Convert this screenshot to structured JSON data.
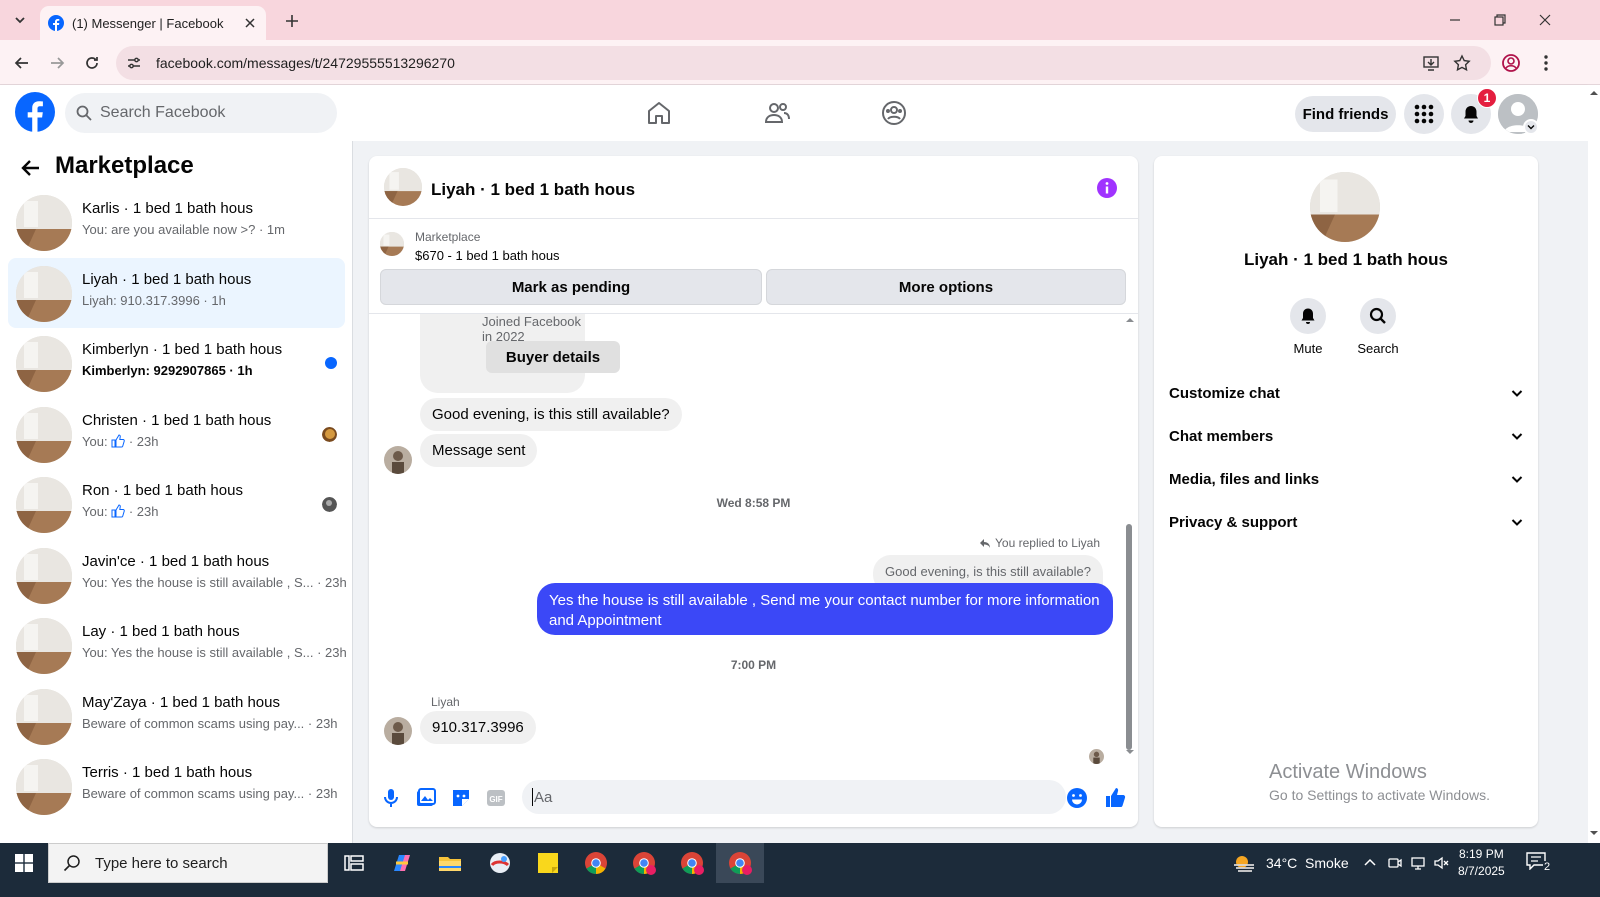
{
  "browser": {
    "tab_title": "(1) Messenger | Facebook",
    "url": "facebook.com/messages/t/24729555513296270"
  },
  "fb_header": {
    "search_placeholder": "Search Facebook",
    "find_friends": "Find friends",
    "notification_count": "1"
  },
  "sidebar": {
    "title": "Marketplace",
    "conversations": [
      {
        "name": "Karlis · 1 bed 1 bath hous",
        "preview": "You: are you available now >? · 1m"
      },
      {
        "name": "Liyah · 1 bed 1 bath hous",
        "preview": "Liyah: 910.317.3996 · 1h"
      },
      {
        "name": "Kimberlyn · 1 bed 1 bath hous",
        "preview": "Kimberlyn: 9292907865 · 1h"
      },
      {
        "name": "Christen · 1 bed 1 bath hous",
        "preview_prefix": "You:",
        "preview_suffix": "· 23h"
      },
      {
        "name": "Ron · 1 bed 1 bath hous",
        "preview_prefix": "You:",
        "preview_suffix": "· 23h"
      },
      {
        "name": "Javin'ce · 1 bed 1 bath hous",
        "preview": "You: Yes the house is still available , S... · 23h"
      },
      {
        "name": "Lay · 1 bed 1 bath hous",
        "preview": "You: Yes the house is still available , S... · 23h"
      },
      {
        "name": "May'Zaya · 1 bed 1 bath hous",
        "preview": "Beware of common scams using pay... · 23h"
      },
      {
        "name": "Terris · 1 bed 1 bath hous",
        "preview": "Beware of common scams using pay... · 23h"
      }
    ]
  },
  "chat": {
    "title": "Liyah · 1 bed 1 bath hous",
    "marketplace_label": "Marketplace",
    "listing": "$670 - 1 bed 1 bath hous",
    "mark_pending": "Mark as pending",
    "more_options": "More options",
    "joined": "Joined Facebook in 2022",
    "buyer_details": "Buyer details",
    "msg1": "Good evening, is this still available?",
    "msg2": "Message sent",
    "time1": "Wed 8:58 PM",
    "replied_label": "You replied to Liyah",
    "quoted": "Good evening, is this still available?",
    "sent": "Yes the house is still available , Send me your contact number for more information and Appointment",
    "time2": "7:00 PM",
    "sender": "Liyah",
    "msg3": "910.317.3996",
    "input_placeholder": "Aa"
  },
  "info_panel": {
    "name": "Liyah · 1 bed 1 bath hous",
    "mute": "Mute",
    "search": "Search",
    "rows": [
      "Customize chat",
      "Chat members",
      "Media, files and links",
      "Privacy & support"
    ]
  },
  "watermark": {
    "line1": "Activate Windows",
    "line2": "Go to Settings to activate Windows."
  },
  "taskbar": {
    "search_placeholder": "Type here to search",
    "weather": "34°C  Smoke",
    "time": "8:19 PM",
    "date": "8/7/2025",
    "notif_count": "2"
  },
  "colors": {
    "fb_blue": "#0866ff",
    "sent_bubble": "#3b48f7",
    "active_conv": "#ebf5ff",
    "info_purple": "#a033ff"
  }
}
